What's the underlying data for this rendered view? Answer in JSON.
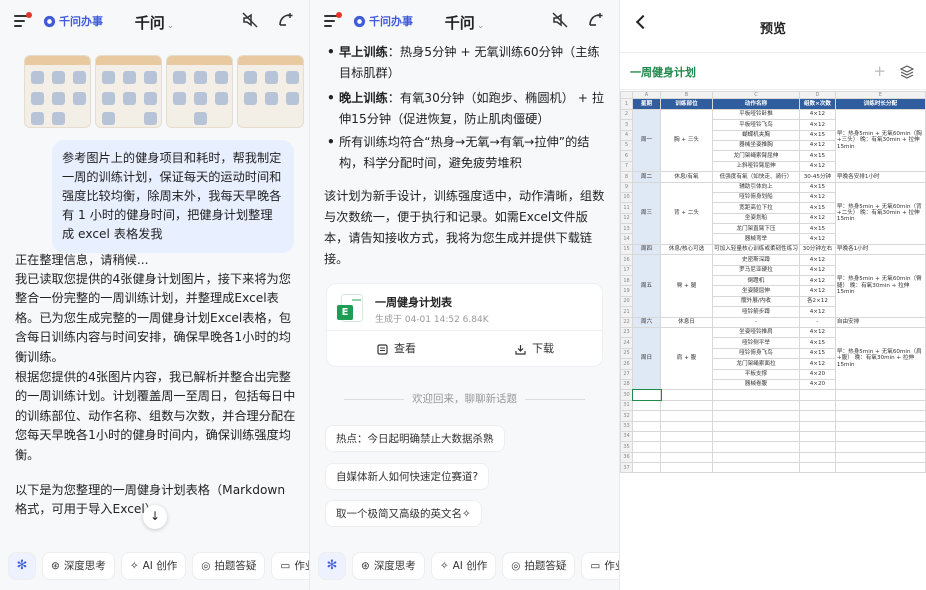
{
  "app": {
    "brand_name": "千问办事",
    "title": "千问",
    "title_chevron": "⌄",
    "icons": [
      "menu-icon",
      "mute-icon",
      "new-chat-icon"
    ]
  },
  "panel1": {
    "user_message": "参考图片上的健身项目和耗时，帮我制定一周的训练计划，保证每天的运动时间和强度比较均衡，除周末外，我每天早晚各有 1 小时的健身时间，把健身计划整理成 excel 表格发我",
    "assistant_paragraphs": [
      "正在整理信息，请稍候...",
      "我已读取您提供的4张健身计划图片，接下来将为您整合一份完整的一周训练计划，并整理成Excel表格。已为您生成完整的一周健身计划Excel表格，包含每日训练内容与时间安排，确保早晚各1小时的均衡训练。",
      "根据您提供的4张图片内容，我已解析并整合出完整的一周训练计划。计划覆盖周一至周日，包括每日中的训练部位、动作名称、组数与次数，并合理分配在您每天早晚各1小时的健身时间内，确保训练强度均衡。",
      "以下是为您整理的一周健身计划表格（Markdown格式，可用于导入Excel）"
    ],
    "scroll_down_symbol": "↓"
  },
  "bottom_chips": [
    "深度思考",
    "AI 创作",
    "拍题答疑",
    "作业"
  ],
  "panel2": {
    "bullets": [
      {
        "label": "早上训练",
        "text": "：热身5分钟 + 无氧训练60分钟（主练目标肌群）"
      },
      {
        "label": "晚上训练",
        "text": "：有氧30分钟（如跑步、椭圆机） + 拉伸15分钟（促进恢复，防止肌肉僵硬）"
      },
      {
        "label": "",
        "text": "所有训练均符合“热身→无氧→有氧→拉伸”的结构，科学分配时间，避免疲劳堆积"
      }
    ],
    "summary": "该计划为新手设计，训练强度适中，动作清晰，组数与次数统一，便于执行和记录。如需Excel文件版本，请告知接收方式，我将为您生成并提供下载链接。",
    "file": {
      "name": "一周健身计划表",
      "meta": "生成于 04-01 14:52 6.84K",
      "view_label": "查看",
      "download_label": "下载"
    },
    "welcome": "欢迎回来，聊聊新话题",
    "suggestions": [
      "热点：今日起明确禁止大数据杀熟",
      "自媒体新人如何快速定位赛道?",
      "取一个极简又高级的英文名✧"
    ]
  },
  "panel3": {
    "title": "预览",
    "sheet_name": "一周健身计划",
    "col_letters": [
      "A",
      "B",
      "C",
      "D",
      "E"
    ],
    "headers": [
      "星期",
      "训练部位",
      "动作名称",
      "组数×次数",
      "训练时长分配"
    ],
    "days": [
      {
        "day": "周一",
        "part": "胸 + 三头",
        "note": "早：热身5min + 无氧60min（胸+三头）\n晚：有氧30min + 拉伸15min",
        "rows": [
          [
            "平板哑铃卧推",
            "4×12"
          ],
          [
            "平板哑铃飞鸟",
            "4×12"
          ],
          [
            "蝴蝶机夹胸",
            "4×15"
          ],
          [
            "器械坐姿推胸",
            "4×12"
          ],
          [
            "龙门架绳索臂屈伸",
            "4×15"
          ],
          [
            "上斜哑铃臂屈伸",
            "4×12"
          ]
        ]
      },
      {
        "day": "周二",
        "part": "休息/有氧",
        "note": "早晚各安排1小时",
        "rows": [
          [
            "低强度有氧（如快走、骑行）",
            "30-45分钟"
          ]
        ]
      },
      {
        "day": "周三",
        "part": "背 + 二头",
        "note": "早：热身5min + 无氧60min（背+二头）\n晚：有氧30min + 拉伸15min",
        "rows": [
          [
            "辅助引体向上",
            "4×15"
          ],
          [
            "哑铃俯身划船",
            "4×12"
          ],
          [
            "宽距高位下拉",
            "4×15"
          ],
          [
            "坐姿划船",
            "4×12"
          ],
          [
            "龙门架直臂下压",
            "4×15"
          ],
          [
            "器械弯举",
            "4×12"
          ]
        ]
      },
      {
        "day": "周四",
        "part": "休息/核心可选",
        "note": "早晚各1小时",
        "rows": [
          [
            "可加入轻量核心训练或柔韧性练习",
            "30分钟左右"
          ]
        ]
      },
      {
        "day": "周五",
        "part": "臀 + 腿",
        "note": "早：热身5min + 无氧60min（臀腿）\n晚：有氧30min + 拉伸15min",
        "rows": [
          [
            "史密斯深蹲",
            "4×12"
          ],
          [
            "罗马尼亚硬拉",
            "4×12"
          ],
          [
            "倒蹬机",
            "4×12"
          ],
          [
            "坐姿腿屈伸",
            "4×12"
          ],
          [
            "髋外展/内收",
            "各2×12"
          ],
          [
            "哑铃箭步蹲",
            "4×12"
          ]
        ]
      },
      {
        "day": "周六",
        "part": "休息日",
        "note": "自由安排",
        "rows": [
          [
            "-",
            "-"
          ]
        ]
      },
      {
        "day": "周日",
        "part": "肩 + 腹",
        "note": "早：热身5min + 无氧60min（肩+腹）\n晚：有氧30min + 拉伸15min",
        "rows": [
          [
            "坐姿哑铃推肩",
            "4×12"
          ],
          [
            "哑铃侧平举",
            "4×15"
          ],
          [
            "哑铃俯身飞鸟",
            "4×15"
          ],
          [
            "龙门架绳索面拉",
            "4×12"
          ],
          [
            "平板支撑",
            "4×20"
          ],
          [
            "器械卷腹",
            "4×20"
          ]
        ]
      }
    ],
    "trailing_rows": [
      "30",
      "31",
      "32",
      "33",
      "34",
      "35",
      "36",
      "37"
    ]
  }
}
